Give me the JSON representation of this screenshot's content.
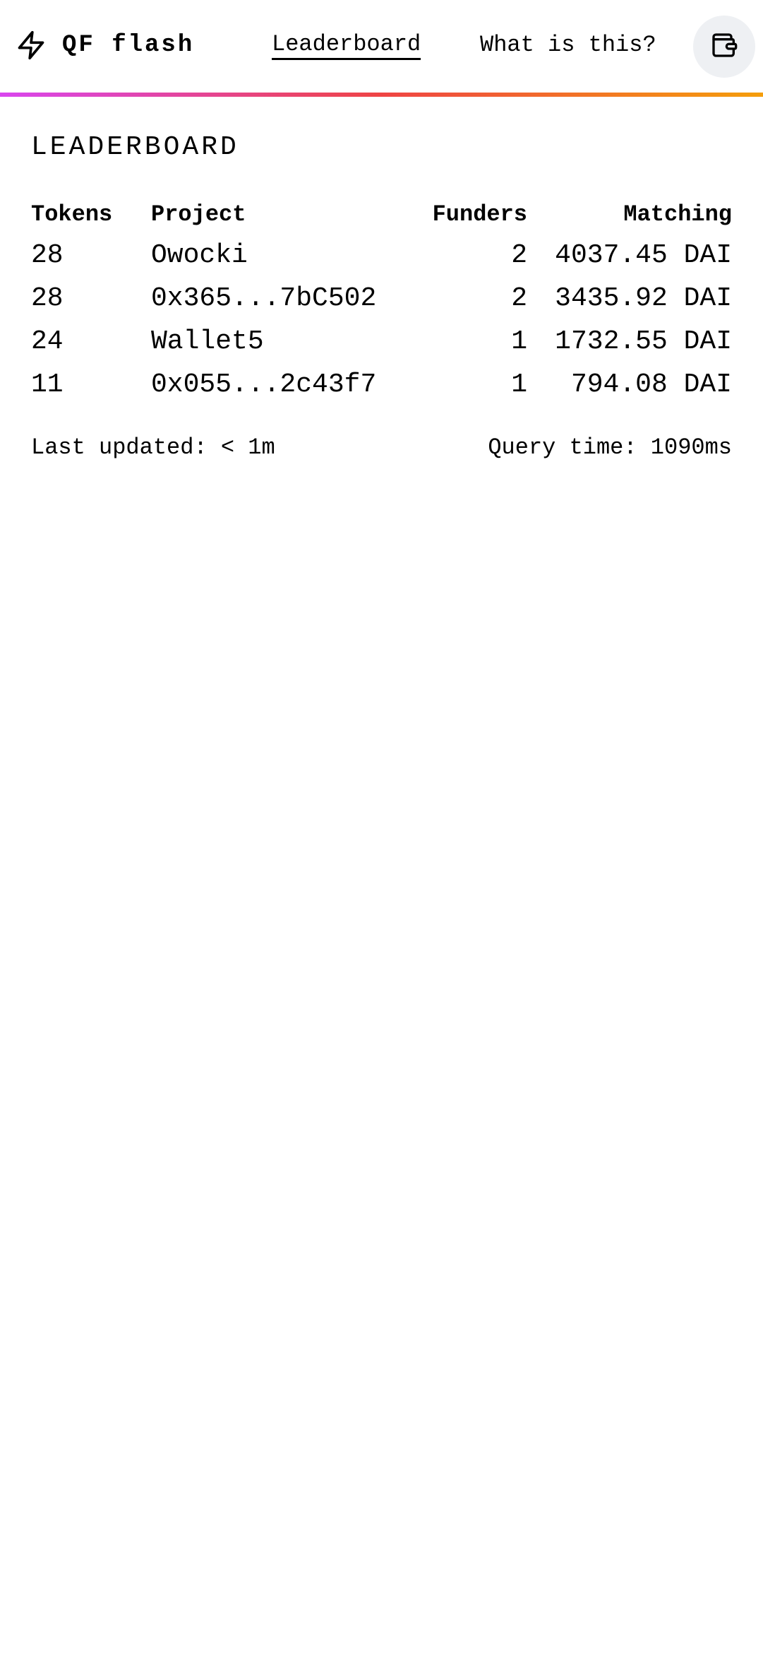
{
  "header": {
    "app_name": "QF flash",
    "logo_icon": "lightning-bolt-icon",
    "nav": [
      {
        "label": "Leaderboard",
        "active": true
      },
      {
        "label": "What is this?",
        "active": false
      }
    ],
    "wallet_icon": "wallet-icon",
    "gradient_colors": [
      "#d946ef",
      "#ef4444",
      "#f59e0b"
    ]
  },
  "leaderboard": {
    "title": "LEADERBOARD",
    "columns": [
      "Tokens",
      "Project",
      "Funders",
      "Matching"
    ],
    "rows": [
      {
        "tokens": "28",
        "project": "Owocki",
        "funders": "2",
        "matching": "4037.45 DAI"
      },
      {
        "tokens": "28",
        "project": "0x365...7bC502",
        "funders": "2",
        "matching": "3435.92 DAI"
      },
      {
        "tokens": "24",
        "project": "Wallet5",
        "funders": "1",
        "matching": "1732.55 DAI"
      },
      {
        "tokens": "11",
        "project": "0x055...2c43f7",
        "funders": "1",
        "matching": "794.08 DAI"
      }
    ]
  },
  "footer": {
    "last_updated": "Last updated: < 1m",
    "query_time": "Query time: 1090ms"
  }
}
